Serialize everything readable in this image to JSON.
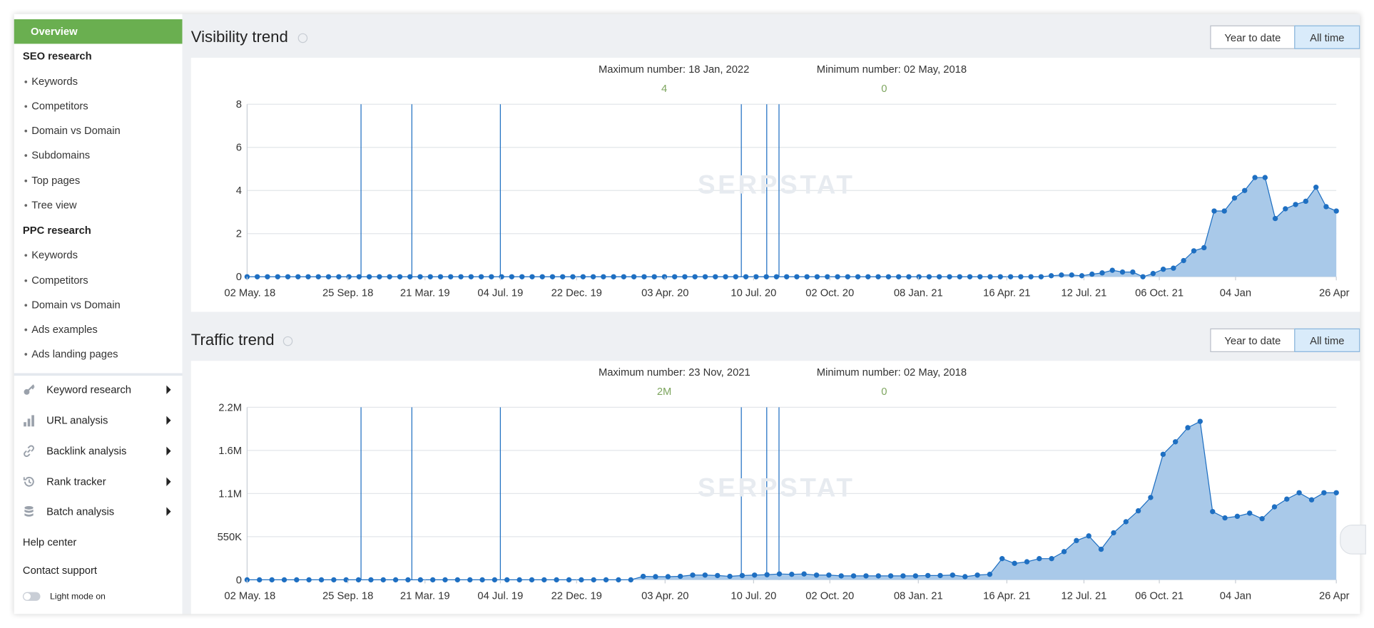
{
  "sidebar": {
    "overview": "Overview",
    "seo_heading": "SEO research",
    "seo_items": [
      "Keywords",
      "Competitors",
      "Domain vs Domain",
      "Subdomains",
      "Top pages",
      "Tree view"
    ],
    "ppc_heading": "PPC research",
    "ppc_items": [
      "Keywords",
      "Competitors",
      "Domain vs Domain",
      "Ads examples",
      "Ads landing pages"
    ],
    "tools": [
      {
        "label": "Keyword research",
        "icon": "key-icon"
      },
      {
        "label": "URL analysis",
        "icon": "bar-chart-icon"
      },
      {
        "label": "Backlink analysis",
        "icon": "link-icon"
      },
      {
        "label": "Rank tracker",
        "icon": "history-icon"
      },
      {
        "label": "Batch analysis",
        "icon": "database-icon"
      }
    ],
    "help": "Help center",
    "support": "Contact support",
    "light_mode": "Light mode on"
  },
  "visibility": {
    "title": "Visibility trend",
    "btn_ytd": "Year to date",
    "btn_all": "All time",
    "max_label": "Maximum number: 18 Jan, 2022",
    "max_value": "4",
    "min_label": "Minimum number: 02 May, 2018",
    "min_value": "0"
  },
  "traffic": {
    "title": "Traffic trend",
    "btn_ytd": "Year to date",
    "btn_all": "All time",
    "max_label": "Maximum number: 23 Nov, 2021",
    "max_value": "2M",
    "min_label": "Minimum number: 02 May, 2018",
    "min_value": "0"
  },
  "watermark": "SERPSTAT",
  "colors": {
    "accent": "#6aaf50",
    "series": "#1e6fc2",
    "fill": "#a9c9e9",
    "active_button": "#d9ebfa"
  },
  "chart_data": [
    {
      "type": "area",
      "title": "Visibility trend",
      "x_tick_labels": [
        "02 May. 18",
        "25 Sep. 18",
        "21 Mar. 19",
        "04 Jul. 19",
        "22 Dec. 19",
        "03 Apr. 20",
        "10 Jul. 20",
        "02 Oct. 20",
        "08 Jan. 21",
        "16 Apr. 21",
        "12 Jul. 21",
        "06 Oct. 21",
        "04 Jan",
        "26 Apr"
      ],
      "y_tick_labels": [
        "0",
        "2",
        "4",
        "6",
        "8"
      ],
      "ylim": [
        0,
        8
      ],
      "grid": true,
      "series": [
        {
          "values": [
            0,
            0,
            0,
            0,
            0,
            0,
            0,
            0,
            0,
            0,
            0,
            0,
            0,
            0,
            0,
            0,
            0,
            0,
            0,
            0,
            0,
            0,
            0,
            0,
            0,
            0,
            0,
            0,
            0,
            0,
            0,
            0,
            0,
            0,
            0,
            0,
            0,
            0,
            0,
            0,
            0,
            0,
            0,
            0,
            0,
            0,
            0,
            0,
            0,
            0,
            0,
            0,
            0,
            0,
            0,
            0,
            0,
            0,
            0,
            0,
            0,
            0,
            0,
            0,
            0,
            0,
            0,
            0,
            0,
            0,
            0,
            0,
            0,
            0,
            0,
            0,
            0,
            0,
            0,
            0.05,
            0.08,
            0.08,
            0.05,
            0.12,
            0.18,
            0.3,
            0.22,
            0.22,
            0,
            0.15,
            0.35,
            0.4,
            0.75,
            1.2,
            1.35,
            3.05,
            3.05,
            3.65,
            4.0,
            4.6,
            4.6,
            2.7,
            3.15,
            3.35,
            3.5,
            4.15,
            3.25,
            3.05
          ]
        }
      ]
    },
    {
      "type": "area",
      "title": "Traffic trend",
      "x_tick_labels": [
        "02 May. 18",
        "25 Sep. 18",
        "21 Mar. 19",
        "04 Jul. 19",
        "22 Dec. 19",
        "03 Apr. 20",
        "10 Jul. 20",
        "02 Oct. 20",
        "08 Jan. 21",
        "16 Apr. 21",
        "12 Jul. 21",
        "06 Oct. 21",
        "04 Jan",
        "26 Apr"
      ],
      "y_tick_labels": [
        "0",
        "550K",
        "1.1M",
        "1.6M",
        "2.2M"
      ],
      "ylim": [
        0,
        2200000
      ],
      "grid": true,
      "series": [
        {
          "values": [
            0,
            0,
            0,
            0,
            0,
            0,
            0,
            0,
            0,
            0,
            0,
            0,
            0,
            0,
            0,
            0,
            0,
            0,
            0,
            0,
            0,
            0,
            0,
            0,
            0,
            0,
            0,
            0,
            0,
            0,
            0,
            0,
            45000,
            40000,
            40000,
            45000,
            60000,
            60000,
            55000,
            45000,
            55000,
            60000,
            65000,
            75000,
            70000,
            75000,
            60000,
            60000,
            50000,
            50000,
            50000,
            50000,
            50000,
            50000,
            50000,
            55000,
            55000,
            60000,
            40000,
            60000,
            70000,
            270000,
            210000,
            230000,
            270000,
            270000,
            360000,
            500000,
            560000,
            390000,
            600000,
            740000,
            880000,
            1050000,
            1600000,
            1760000,
            1940000,
            2020000,
            870000,
            790000,
            810000,
            850000,
            780000,
            930000,
            1030000,
            1110000,
            1020000,
            1110000,
            1110000
          ]
        }
      ]
    }
  ]
}
